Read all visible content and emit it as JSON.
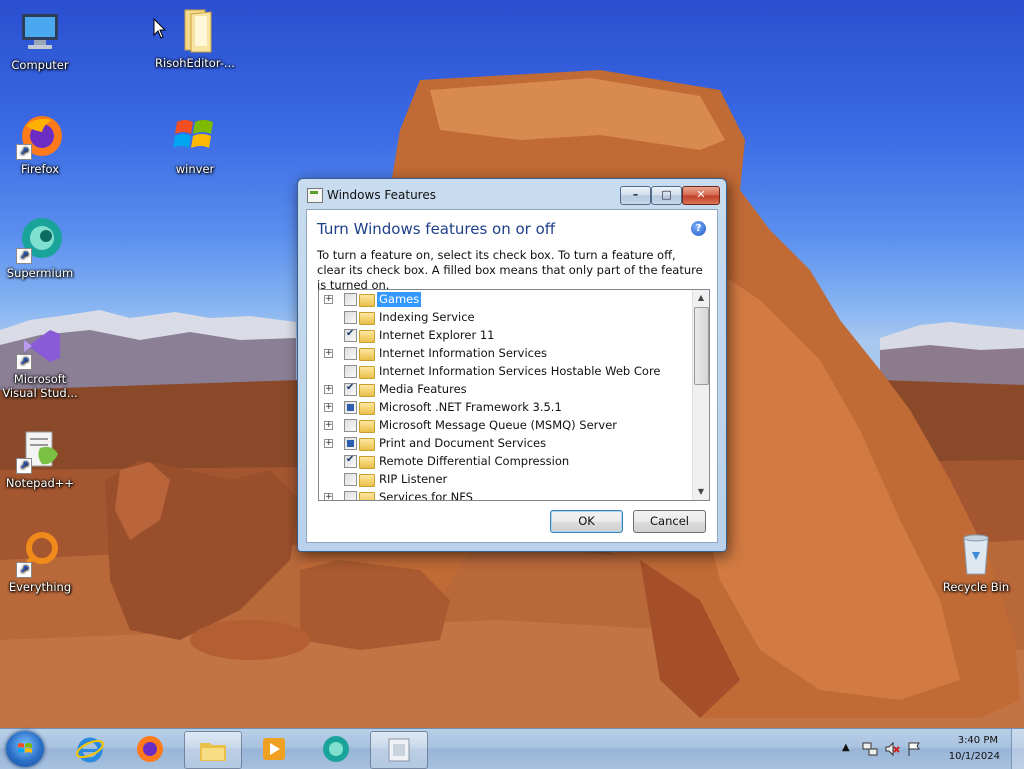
{
  "desktop": {
    "icons": [
      {
        "label": "Computer",
        "name": "computer"
      },
      {
        "label": "RisohEditor-...",
        "name": "risoheditor"
      },
      {
        "label": "Firefox",
        "name": "firefox"
      },
      {
        "label": "winver",
        "name": "winver"
      },
      {
        "label": "Supermium",
        "name": "supermium"
      },
      {
        "label": "Microsoft Visual Stud...",
        "name": "visual-studio"
      },
      {
        "label": "Notepad++",
        "name": "notepadpp"
      },
      {
        "label": "Everything",
        "name": "everything"
      },
      {
        "label": "Recycle Bin",
        "name": "recycle-bin"
      }
    ]
  },
  "dialog": {
    "title": "Windows Features",
    "heading": "Turn Windows features on or off",
    "description": "To turn a feature on, select its check box. To turn a feature off, clear its check box. A filled box means that only part of the feature is turned on.",
    "help_icon": "help-icon",
    "controls": {
      "minimize": "–",
      "maximize": "□",
      "close": "✕"
    },
    "features": [
      {
        "label": "Games",
        "expandable": true,
        "state": "unchecked",
        "selected": true
      },
      {
        "label": "Indexing Service",
        "expandable": false,
        "state": "unchecked",
        "selected": false
      },
      {
        "label": "Internet Explorer 11",
        "expandable": false,
        "state": "checked",
        "selected": false
      },
      {
        "label": "Internet Information Services",
        "expandable": true,
        "state": "unchecked",
        "selected": false
      },
      {
        "label": "Internet Information Services Hostable Web Core",
        "expandable": false,
        "state": "unchecked",
        "selected": false
      },
      {
        "label": "Media Features",
        "expandable": true,
        "state": "checked",
        "selected": false
      },
      {
        "label": "Microsoft .NET Framework 3.5.1",
        "expandable": true,
        "state": "partial",
        "selected": false
      },
      {
        "label": "Microsoft Message Queue (MSMQ) Server",
        "expandable": true,
        "state": "unchecked",
        "selected": false
      },
      {
        "label": "Print and Document Services",
        "expandable": true,
        "state": "partial",
        "selected": false
      },
      {
        "label": "Remote Differential Compression",
        "expandable": false,
        "state": "checked",
        "selected": false
      },
      {
        "label": "RIP Listener",
        "expandable": false,
        "state": "unchecked",
        "selected": false
      },
      {
        "label": "Services for NFS",
        "expandable": true,
        "state": "unchecked",
        "selected": false
      }
    ],
    "ok_label": "OK",
    "cancel_label": "Cancel"
  },
  "taskbar": {
    "start_label": "Start",
    "items": [
      {
        "name": "internet-explorer",
        "active": false
      },
      {
        "name": "firefox",
        "active": false
      },
      {
        "name": "windows-explorer",
        "active": true
      },
      {
        "name": "media-player",
        "active": false
      },
      {
        "name": "supermium",
        "active": false
      },
      {
        "name": "windows-features",
        "active": true
      }
    ],
    "tray": {
      "time": "3:40 PM",
      "date": "10/1/2024"
    }
  },
  "colors": {
    "accent": "#1e3f8a",
    "selection": "#3399ff"
  }
}
